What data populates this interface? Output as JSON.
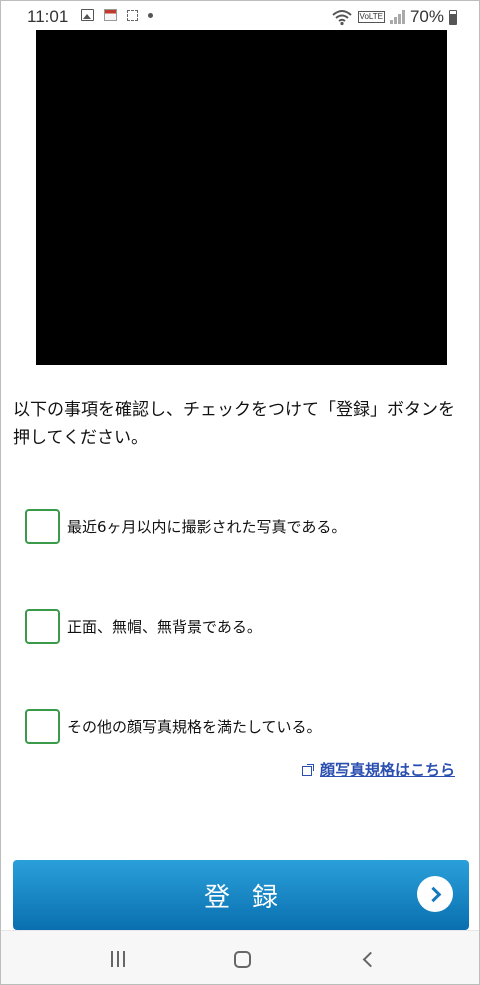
{
  "status_bar": {
    "time": "11:01",
    "battery": "70%",
    "left_icons": [
      "image-icon",
      "news-icon",
      "expand-icon",
      "dot-icon"
    ],
    "right_icons": [
      "wifi-icon",
      "volte-icon",
      "signal-icon",
      "battery-icon"
    ],
    "volte_label": "VoLTE"
  },
  "instructions": "以下の事項を確認し、チェックをつけて「登録」ボタンを押してください。",
  "checks": [
    {
      "label": "最近6ヶ月以内に撮影された写真である。",
      "checked": false
    },
    {
      "label": "正面、無帽、無背景である。",
      "checked": false
    },
    {
      "label": "その他の顔写真規格を満たしている。",
      "checked": false
    }
  ],
  "spec_link": "顔写真規格はこちら",
  "register_button": "登録",
  "colors": {
    "checkbox_border": "#3a9a4a",
    "link": "#2b4fb0",
    "button_top": "#2aa0da",
    "button_bottom": "#0a6fb0",
    "camera_preview": "#000000"
  },
  "nav": {
    "icons": [
      "recent-apps-icon",
      "home-icon",
      "back-icon"
    ]
  }
}
